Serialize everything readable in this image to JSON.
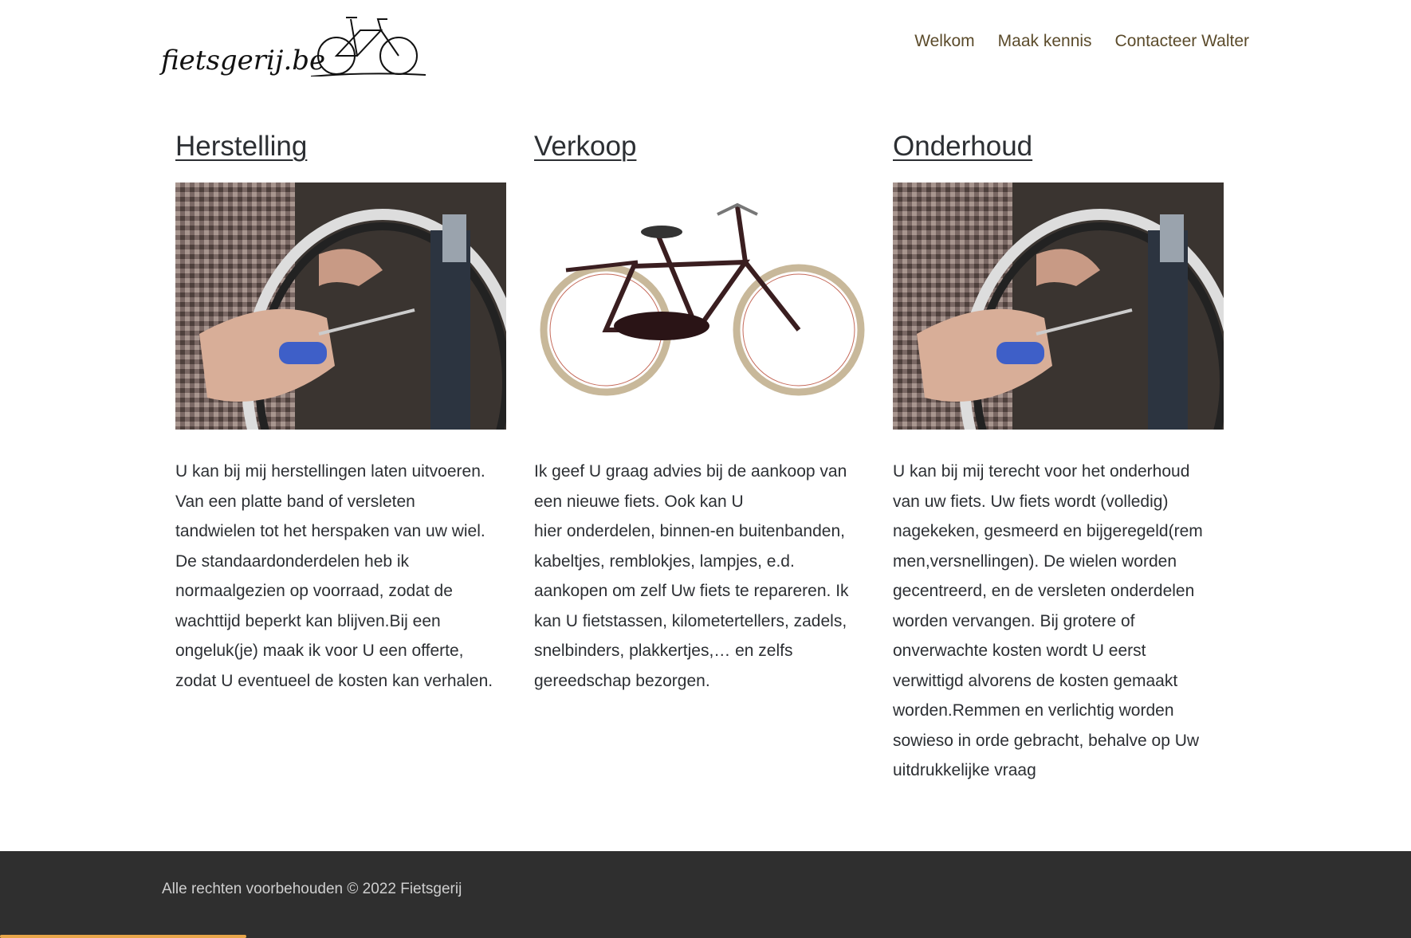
{
  "header": {
    "logo_text": "fietsgerij.be",
    "nav": [
      "Welkom",
      "Maak kennis",
      "Contacteer Walter"
    ]
  },
  "columns": [
    {
      "title": "Herstelling",
      "image": "repair-photo",
      "text": "U kan bij mij herstellingen laten uitvoeren.\nVan een platte band of versleten\ntandwielen tot het herspaken van uw wiel.\nDe standaardonderdelen heb ik\nnormaalgezien op voorraad, zodat de\nwachttijd beperkt kan blijven.Bij een\nongeluk(je) maak ik voor U een offerte,\nzodat U eventueel de kosten kan verhalen."
    },
    {
      "title": "Verkoop",
      "image": "bicycle-photo",
      "text": "Ik geef U graag advies bij de aankoop van\neen nieuwe fiets. Ook kan U\nhier onderdelen, binnen-en buitenbanden,\nkabeltjes, remblokjes, lampjes, e.d.\naankopen om zelf Uw fiets te repareren.  Ik\nkan U fietstassen, kilometertellers, zadels,\nsnelbinders, plakkertjes,… en zelfs\ngereedschap bezorgen."
    },
    {
      "title": "Onderhoud",
      "image": "repair-photo",
      "text": "U kan bij mij terecht voor het onderhoud\nvan uw fiets.  Uw fiets wordt (volledig)\nnagekeken, gesmeerd en bijgeregeld(rem\nmen,versnellingen).  De wielen worden\ngecentreerd, en de versleten onderdelen\nworden vervangen.  Bij grotere of\nonverwachte kosten wordt U eerst\nverwittigd alvorens de kosten gemaakt\nworden.Remmen en verlichtig worden\nsowieso in orde gebracht, behalve op Uw\nuitdrukkelijke vraag"
    }
  ],
  "footer": {
    "copyright": "Alle rechten voorbehouden © 2022 Fietsgerij"
  },
  "colors": {
    "nav": "#5b4b2b",
    "text": "#2c2f33",
    "footer_bg": "#2f2f2f",
    "accent": "#e8a64a"
  }
}
